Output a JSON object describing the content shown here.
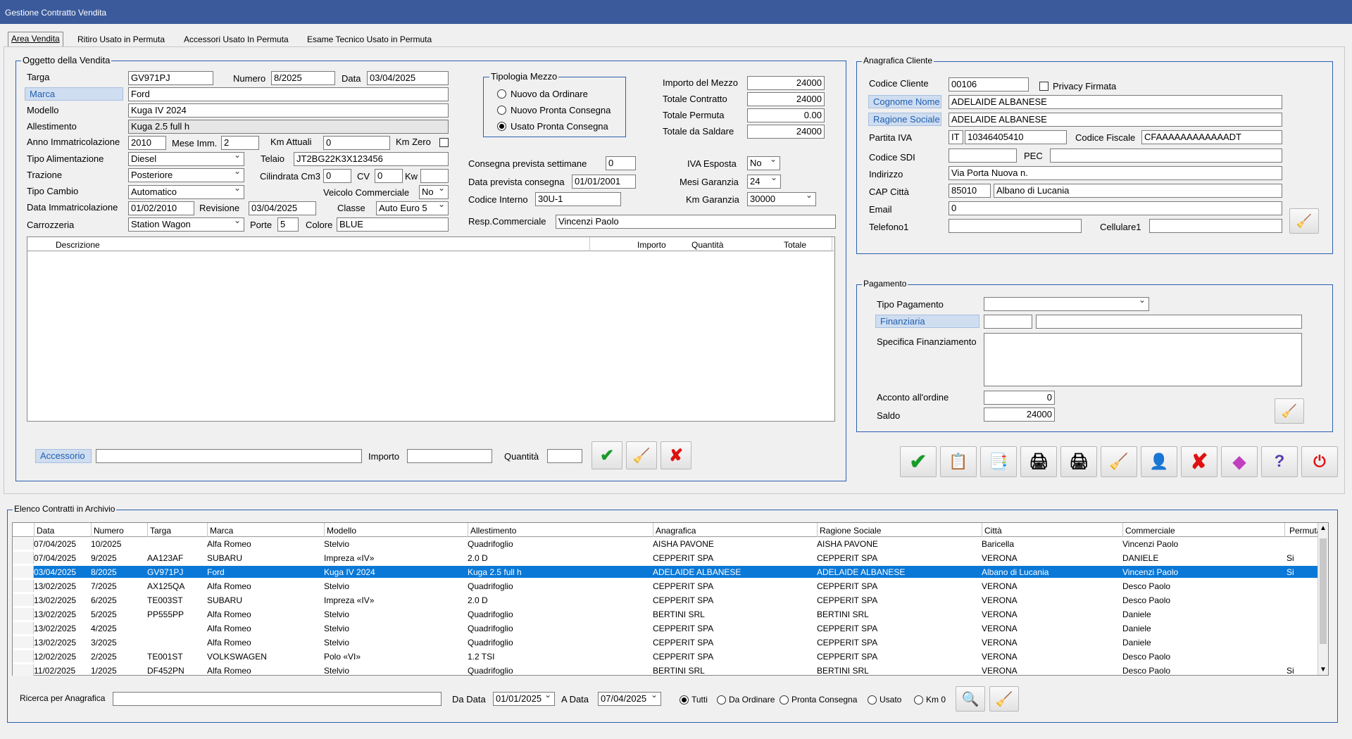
{
  "window": {
    "title": "Gestione Contratto Vendita"
  },
  "tabs": [
    "Area Vendita",
    "Ritiro Usato in Permuta",
    "Accessori Usato In Permuta",
    "Esame Tecnico Usato in Permuta"
  ],
  "oggetto": {
    "title": "Oggetto della Vendita",
    "targa_label": "Targa",
    "targa": "GV971PJ",
    "numero_label": "Numero",
    "numero": "8/2025",
    "data_label": "Data",
    "data": "03/04/2025",
    "marca_label": "Marca",
    "marca": "Ford",
    "modello_label": "Modello",
    "modello": "Kuga IV 2024",
    "allestimento_label": "Allestimento",
    "allestimento": "Kuga 2.5 full h",
    "anno_label": "Anno Immatricolazione",
    "anno": "2010",
    "mese_label": "Mese Imm.",
    "mese": "2",
    "km_label": "Km Attuali",
    "km": "0",
    "kmzero_label": "Km Zero",
    "alim_label": "Tipo Alimentazione",
    "alim": "Diesel",
    "telaio_label": "Telaio",
    "telaio": "JT2BG22K3X123456",
    "trazione_label": "Trazione",
    "trazione": "Posteriore",
    "cil_label": "Cilindrata Cm3",
    "cil": "0",
    "cv_label": "CV",
    "cv": "0",
    "kw_label": "Kw",
    "kw": "",
    "cambio_label": "Tipo Cambio",
    "cambio": "Automatico",
    "commerciale_label": "Veicolo Commerciale",
    "commerciale": "No",
    "dataimm_label": "Data Immatricolazione",
    "dataimm": "01/02/2010",
    "revisione_label": "Revisione",
    "revisione": "03/04/2025",
    "classe_label": "Classe",
    "classe": "Auto Euro 5",
    "carrozzeria_label": "Carrozzeria",
    "carrozzeria": "Station Wagon",
    "porte_label": "Porte",
    "porte": "5",
    "colore_label": "Colore",
    "colore": "BLUE"
  },
  "tipologia": {
    "title": "Tipologia Mezzo",
    "options": [
      "Nuovo da Ordinare",
      "Nuovo Pronta Consegna",
      "Usato Pronta Consegna"
    ],
    "selected": 2
  },
  "importi": {
    "importo_label": "Importo del Mezzo",
    "importo": "24000",
    "totale_label": "Totale Contratto",
    "totale": "24000",
    "permuta_label": "Totale Permuta",
    "permuta": "0.00",
    "saldare_label": "Totale da Saldare",
    "saldare": "24000",
    "iva_label": "IVA Esposta",
    "iva": "No",
    "mesi_label": "Mesi Garanzia",
    "mesi": "24",
    "kmgar_label": "Km Garanzia",
    "kmgar": "30000"
  },
  "consegna": {
    "settimane_label": "Consegna prevista settimane",
    "settimane": "0",
    "data_label": "Data prevista consegna",
    "data": "01/01/2001",
    "codice_label": "Codice Interno",
    "codice": "30U-1",
    "resp_label": "Resp.Commerciale",
    "resp": "Vincenzi Paolo"
  },
  "accessori": {
    "cols": [
      "Descrizione",
      "Importo",
      "Quantità",
      "Totale"
    ],
    "accessorio_label": "Accessorio",
    "importo_label": "Importo",
    "quantita_label": "Quantità"
  },
  "cliente": {
    "title": "Anagrafica Cliente",
    "codice_label": "Codice Cliente",
    "codice": "00106",
    "privacy_label": "Privacy Firmata",
    "cognome_label": "Cognome Nome",
    "cognome": "ADELAIDE ALBANESE",
    "ragione_label": "Ragione Sociale",
    "ragione": "ADELAIDE ALBANESE",
    "piva_label": "Partita IVA",
    "piva_prefix": "IT",
    "piva": "10346405410",
    "cf_label": "Codice Fiscale",
    "cf": "CFAAAAAAAAAAAADT",
    "sdi_label": "Codice SDI",
    "sdi": "",
    "pec_label": "PEC",
    "pec": "",
    "indirizzo_label": "Indirizzo",
    "indirizzo": "Via Porta Nuova n.",
    "cap_label": "CAP Città",
    "cap": "85010",
    "citta": "Albano di Lucania",
    "email_label": "Email",
    "email": "0",
    "tel_label": "Telefono1",
    "tel": "",
    "cell_label": "Cellulare1",
    "cell": ""
  },
  "pagamento": {
    "title": "Pagamento",
    "tipo_label": "Tipo Pagamento",
    "tipo": "",
    "fin_label": "Finanziaria",
    "fin_code": "",
    "fin_name": "",
    "spec_label": "Specifica Finanziamento",
    "spec": "",
    "acconto_label": "Acconto all'ordine",
    "acconto": "0",
    "saldo_label": "Saldo",
    "saldo": "24000"
  },
  "elenco": {
    "title": "Elenco Contratti in Archivio",
    "cols": [
      "Data",
      "Numero",
      "Targa",
      "Marca",
      "Modello",
      "Allestimento",
      "Anagrafica",
      "Ragione Sociale",
      "Città",
      "Commerciale",
      "Permuta"
    ],
    "rows": [
      [
        "07/04/2025",
        "10/2025",
        "",
        "Alfa Romeo",
        "Stelvio",
        "Quadrifoglio",
        "AISHA PAVONE",
        "AISHA PAVONE",
        "Baricella",
        "Vincenzi Paolo",
        ""
      ],
      [
        "07/04/2025",
        "9/2025",
        "AA123AF",
        "SUBARU",
        "Impreza «IV»",
        "2.0 D",
        "CEPPERIT SPA",
        "CEPPERIT SPA",
        "VERONA",
        "DANIELE",
        "Si"
      ],
      [
        "03/04/2025",
        "8/2025",
        "GV971PJ",
        "Ford",
        "Kuga IV 2024",
        "Kuga 2.5 full h",
        "ADELAIDE ALBANESE",
        "ADELAIDE ALBANESE",
        "Albano di Lucania",
        "Vincenzi Paolo",
        "Si"
      ],
      [
        "13/02/2025",
        "7/2025",
        "AX125QA",
        "Alfa Romeo",
        "Stelvio",
        "Quadrifoglio",
        "CEPPERIT SPA",
        "CEPPERIT SPA",
        "VERONA",
        "Desco Paolo",
        ""
      ],
      [
        "13/02/2025",
        "6/2025",
        "TE003ST",
        "SUBARU",
        "Impreza «IV»",
        "2.0 D",
        "CEPPERIT SPA",
        "CEPPERIT SPA",
        "VERONA",
        "Desco Paolo",
        ""
      ],
      [
        "13/02/2025",
        "5/2025",
        "PP555PP",
        "Alfa Romeo",
        "Stelvio",
        "Quadrifoglio",
        "BERTINI SRL",
        "BERTINI SRL",
        "VERONA",
        "Daniele",
        ""
      ],
      [
        "13/02/2025",
        "4/2025",
        "",
        "Alfa Romeo",
        "Stelvio",
        "Quadrifoglio",
        "CEPPERIT SPA",
        "CEPPERIT SPA",
        "VERONA",
        "Daniele",
        ""
      ],
      [
        "13/02/2025",
        "3/2025",
        "",
        "Alfa Romeo",
        "Stelvio",
        "Quadrifoglio",
        "CEPPERIT SPA",
        "CEPPERIT SPA",
        "VERONA",
        "Daniele",
        ""
      ],
      [
        "12/02/2025",
        "2/2025",
        "TE001ST",
        "VOLKSWAGEN",
        "Polo «VI»",
        "1.2 TSI",
        "CEPPERIT SPA",
        "CEPPERIT SPA",
        "VERONA",
        "Desco Paolo",
        ""
      ],
      [
        "11/02/2025",
        "1/2025",
        "DF452PN",
        "Alfa Romeo",
        "Stelvio",
        "Quadrifoglio",
        "BERTINI SRL",
        "BERTINI SRL",
        "VERONA",
        "Desco Paolo",
        "Si"
      ]
    ],
    "selected_row": 2,
    "ricerca_label": "Ricerca per Anagrafica",
    "ricerca": "",
    "dadata_label": "Da Data",
    "dadata": "01/01/2025",
    "adata_label": "A Data",
    "adata": "07/04/2025",
    "filters": [
      "Tutti",
      "Da Ordinare",
      "Pronta Consegna",
      "Usato",
      "Km 0"
    ],
    "filter_selected": 0
  },
  "toolbar": [
    "confirm",
    "document-list",
    "document-copy",
    "car-print",
    "car-print-2",
    "clear",
    "person",
    "cancel",
    "cube",
    "help",
    "exit"
  ]
}
